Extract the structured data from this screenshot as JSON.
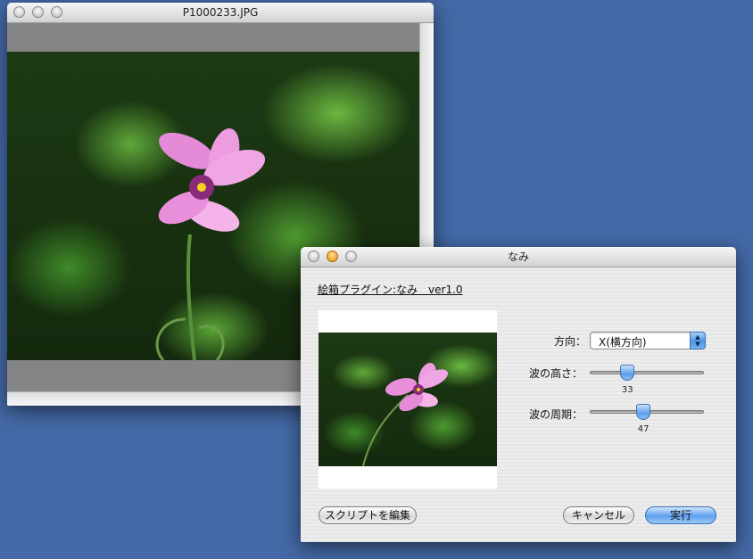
{
  "viewer": {
    "title": "P1000233.JPG"
  },
  "dialog": {
    "title": "なみ",
    "plugin_title": "絵箱プラグイン:なみ　ver1.0",
    "direction": {
      "label": "方向：",
      "value": "X(横方向)"
    },
    "wave_height": {
      "label": "波の高さ：",
      "value": "33",
      "fraction": 0.33
    },
    "wave_period": {
      "label": "波の周期：",
      "value": "47",
      "fraction": 0.47
    },
    "buttons": {
      "edit_script": "スクリプトを編集",
      "cancel": "キャンセル",
      "execute": "実行"
    }
  },
  "colors": {
    "desktop": "#4469a6",
    "accent": "#5f9ff0"
  }
}
